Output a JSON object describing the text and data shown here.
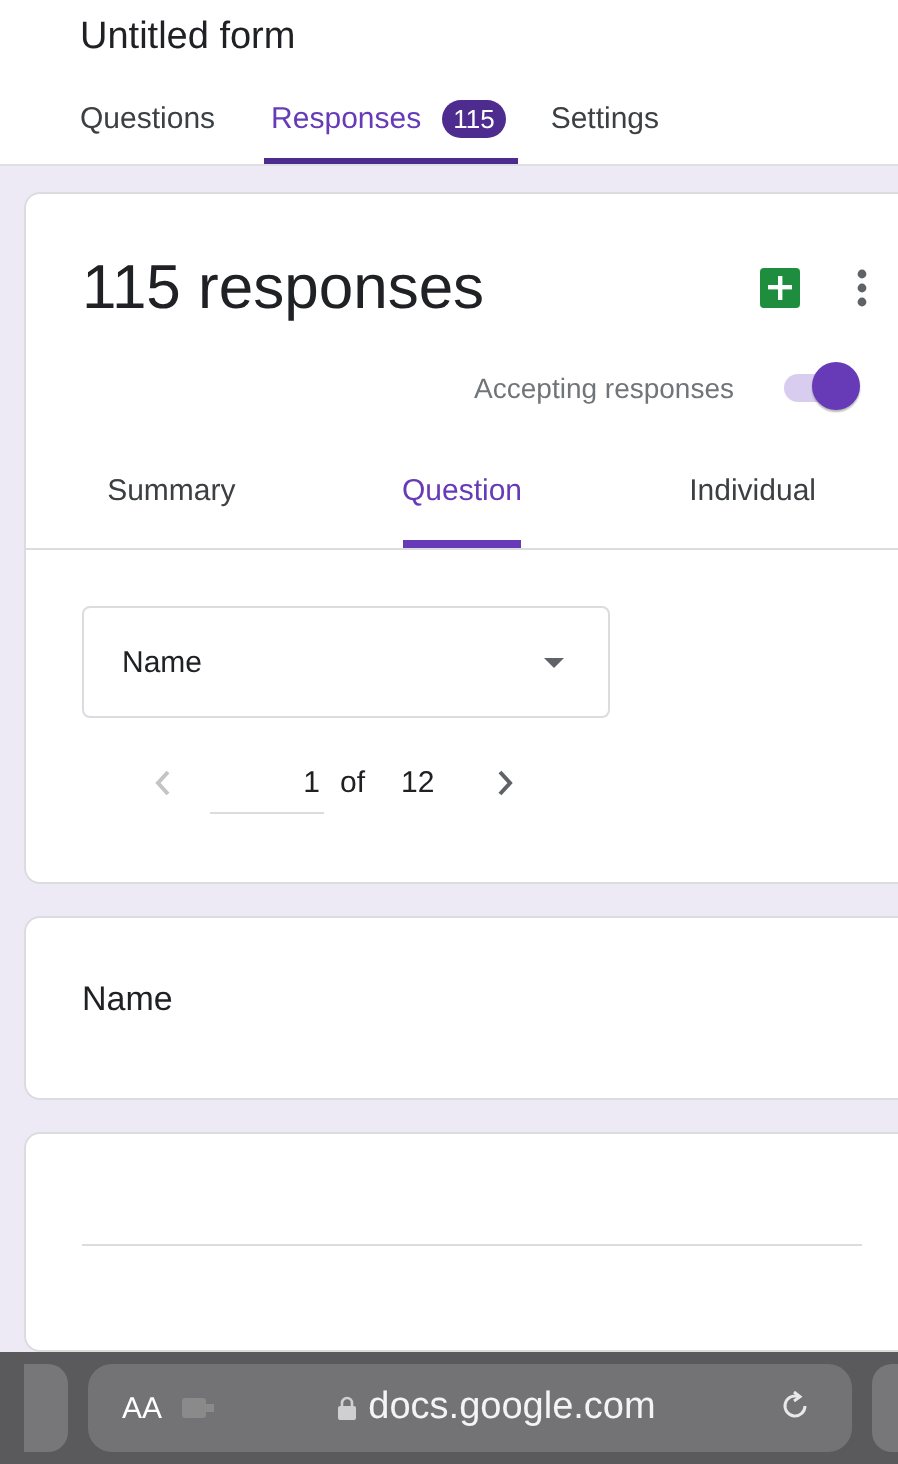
{
  "form_title": "Untitled form",
  "tabs": [
    {
      "label": "Questions",
      "selected": false
    },
    {
      "label": "Responses",
      "selected": true,
      "badge": "115"
    },
    {
      "label": "Settings",
      "selected": false
    }
  ],
  "responses_card": {
    "title": "115 responses",
    "accepting_label": "Accepting responses",
    "accepting_on": true,
    "view_tabs": [
      {
        "label": "Summary",
        "selected": false
      },
      {
        "label": "Question",
        "selected": true
      },
      {
        "label": "Individual",
        "selected": false
      }
    ],
    "question_select": {
      "value": "Name"
    },
    "pager": {
      "current": "1",
      "of": "of",
      "total": "12",
      "prev_disabled": true,
      "next_disabled": false
    }
  },
  "question_card": {
    "title": "Name"
  },
  "browser_bar": {
    "text_size": "AA",
    "url": "docs.google.com"
  }
}
